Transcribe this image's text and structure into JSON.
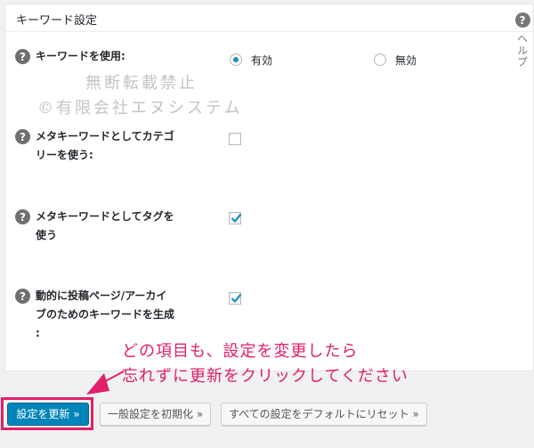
{
  "panel": {
    "title": "キーワード設定"
  },
  "help_tab": {
    "icon": "question-icon",
    "label": "ヘルプ"
  },
  "rows": [
    {
      "label": "キーワードを使用:",
      "options": [
        {
          "label": "有効",
          "checked": true
        },
        {
          "label": "無効",
          "checked": false
        }
      ]
    },
    {
      "label_lines": [
        "メタキーワードとしてカテゴ",
        "リーを使う:"
      ],
      "checked": false
    },
    {
      "label_lines": [
        "メタキーワードとしてタグを",
        "使う"
      ],
      "checked": true
    },
    {
      "label_lines": [
        "動的に投稿ページ/アーカイ",
        "ブのためのキーワードを生成",
        ":"
      ],
      "checked": true
    }
  ],
  "watermark": {
    "line1": "無断転載禁止",
    "line2": "©有限会社エヌシステム"
  },
  "annotation": {
    "line1": "どの項目も、設定を変更したら",
    "line2": "忘れずに更新をクリックしてください",
    "color": "#e0206a"
  },
  "buttons": {
    "update": "設定を更新 »",
    "reset_general": "一般設定を初期化 »",
    "reset_all": "すべての設定をデフォルトにリセット »"
  },
  "colors": {
    "primary": "#0085ba",
    "accent": "#e0206a",
    "check": "#1e8cbe"
  }
}
